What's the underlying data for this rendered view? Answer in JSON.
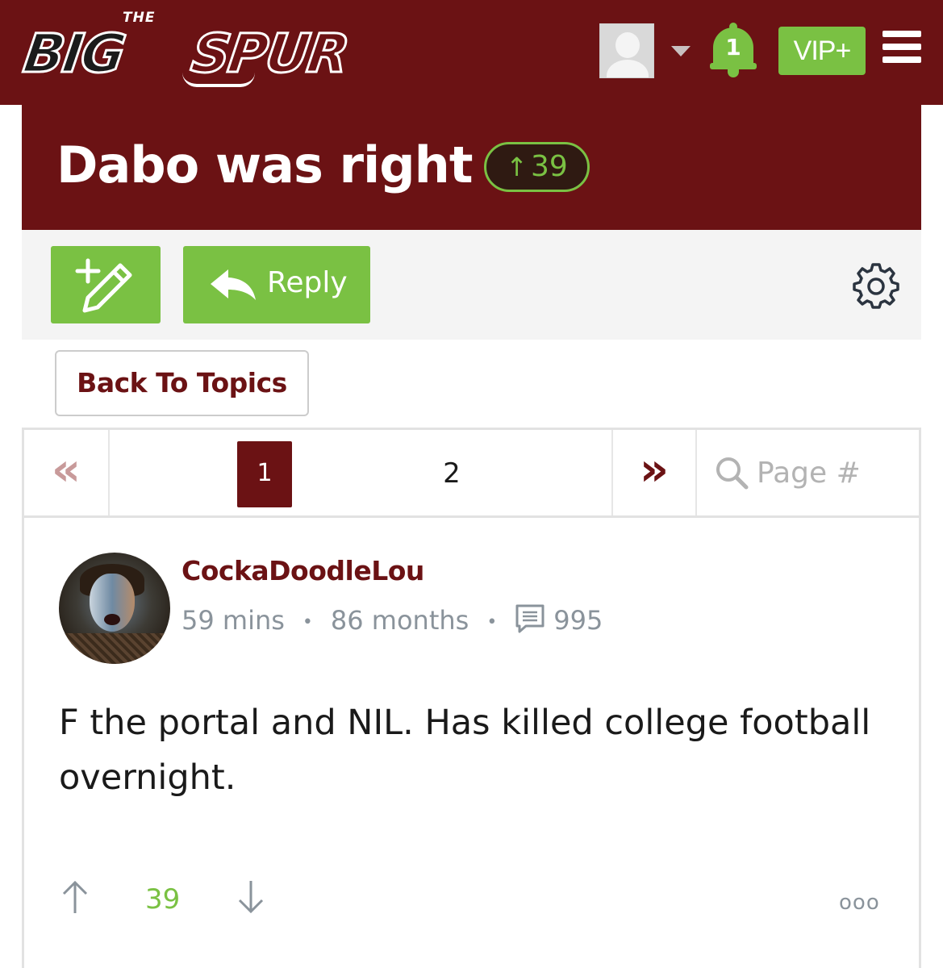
{
  "header": {
    "logo_top": "THE",
    "logo_big": "BIG",
    "logo_spur": "SPUR",
    "notification_count": "1",
    "vip_label": "VIP+"
  },
  "topic": {
    "title": "Dabo was right",
    "vote_arrow": "↑",
    "vote_count": "39"
  },
  "toolbar": {
    "new_topic_icon": "new-topic-pencil-icon",
    "reply_label": "Reply",
    "settings_icon": "gear-icon"
  },
  "back_label": "Back To Topics",
  "pagination": {
    "first": "«",
    "pages": [
      "1",
      "2"
    ],
    "current_page": "1",
    "last": "»",
    "search_placeholder": "Page #"
  },
  "post": {
    "username": "CockaDoodleLou",
    "time": "59 mins",
    "tenure": "86 months",
    "post_count": "995",
    "text": "F the portal and NIL. Has killed college football overnight.",
    "score": "39",
    "more": "ooo"
  },
  "colors": {
    "brand_maroon": "#6b1214",
    "accent_green": "#7ac143",
    "muted_gray": "#8a939b"
  }
}
